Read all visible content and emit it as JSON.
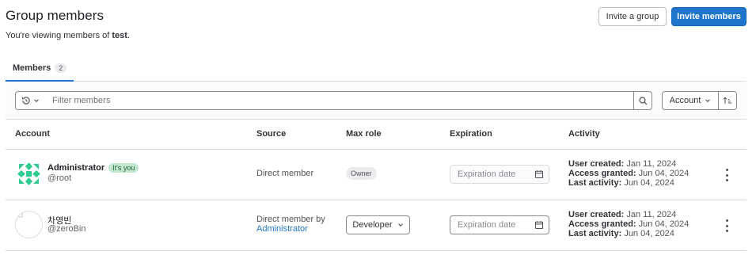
{
  "header": {
    "title": "Group members",
    "subtitle_prefix": "You're viewing members of ",
    "group_name": "test",
    "subtitle_suffix": ".",
    "invite_group_label": "Invite a group",
    "invite_members_label": "Invite members"
  },
  "tabs": [
    {
      "label": "Members",
      "count": "2"
    }
  ],
  "filter": {
    "placeholder": "Filter members",
    "sort_label": "Account"
  },
  "table": {
    "columns": [
      "Account",
      "Source",
      "Max role",
      "Expiration",
      "Activity"
    ],
    "rows": [
      {
        "name": "Administrator",
        "you_badge": "It's you",
        "username": "@root",
        "source": "Direct member",
        "role": "Owner",
        "expiration_placeholder": "Expiration date",
        "user_created_label": "User created:",
        "user_created": "Jan 11, 2024",
        "access_granted_label": "Access granted:",
        "access_granted": "Jun 04, 2024",
        "last_activity_label": "Last activity:",
        "last_activity": "Jun 04, 2024"
      },
      {
        "name": "차영빈",
        "username": "@zeroBin",
        "source_line1": "Direct member by",
        "source_link": "Administrator",
        "role": "Developer",
        "expiration_placeholder": "Expiration date",
        "user_created_label": "User created:",
        "user_created": "Jan 11, 2024",
        "access_granted_label": "Access granted:",
        "access_granted": "Jun 04, 2024",
        "last_activity_label": "Last activity:",
        "last_activity": "Jun 04, 2024"
      }
    ]
  },
  "colors": {
    "primary": "#1f75cb",
    "you_badge_bg": "#c3e6cd",
    "avatar_identicon": "#2ecc8e"
  }
}
